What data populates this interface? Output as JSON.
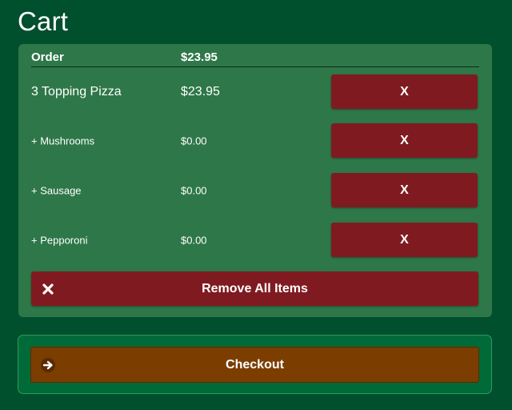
{
  "page": {
    "title": "Cart"
  },
  "order": {
    "header_label": "Order",
    "total": "$23.95",
    "items": [
      {
        "name": "3 Topping Pizza",
        "price": "$23.95",
        "remove_label": "X"
      },
      {
        "name": "+ Mushrooms",
        "price": "$0.00",
        "remove_label": "X"
      },
      {
        "name": "+ Sausage",
        "price": "$0.00",
        "remove_label": "X"
      },
      {
        "name": "+ Pepporoni",
        "price": "$0.00",
        "remove_label": "X"
      }
    ],
    "remove_all_label": "Remove All Items",
    "remove_all_icon": "close-x-icon"
  },
  "checkout": {
    "label": "Checkout",
    "icon": "arrow-right-circle-icon"
  },
  "colors": {
    "background": "#004f2d",
    "cart_panel": "#2e7748",
    "remove_button": "#7f1b20",
    "checkout_panel": "#006b38",
    "checkout_button": "#7c3d00"
  }
}
